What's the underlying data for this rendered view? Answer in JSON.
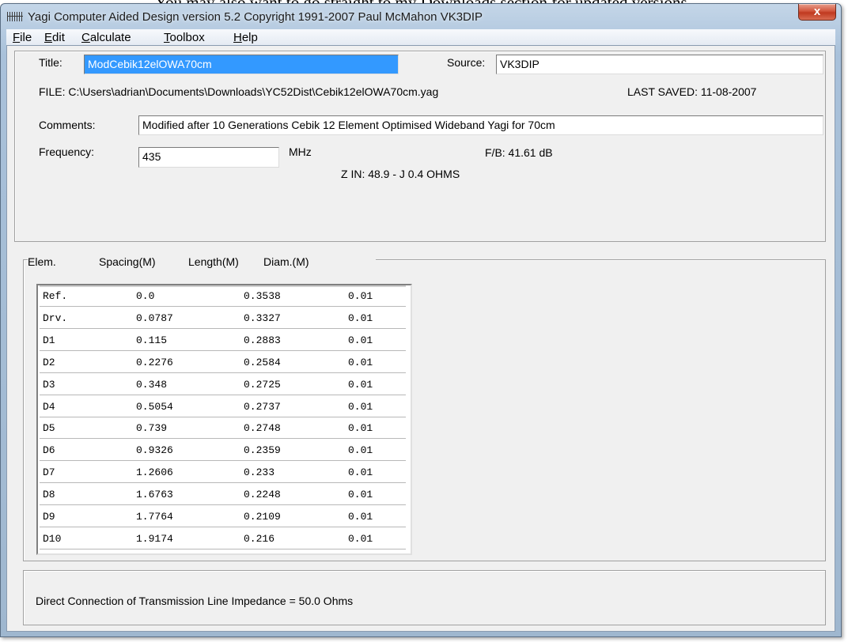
{
  "window": {
    "title": "Yagi Computer Aided Design version 5.2 Copyright 1991-2007 Paul McMahon VK3DIP",
    "close_label": "x",
    "icon": "antenna-grid-icon"
  },
  "background_text": "You may also want to go straight to my Downloads section for updated versions",
  "menu": [
    {
      "label": "File",
      "accel": "F",
      "rest": "ile"
    },
    {
      "label": "Edit",
      "accel": "E",
      "rest": "dit"
    },
    {
      "label": "Calculate",
      "accel": "C",
      "rest": "alculate"
    },
    {
      "label": "Toolbox",
      "accel": "T",
      "rest": "oolbox"
    },
    {
      "label": "Help",
      "accel": "H",
      "rest": "elp"
    }
  ],
  "design": {
    "title_label": "Title:",
    "title_value": "ModCebik12elOWA70cm",
    "source_label": "Source:",
    "source_value": "VK3DIP",
    "file_line": "FILE: C:\\Users\\adrian\\Documents\\Downloads\\YC52Dist\\Cebik12elOWA70cm.yag",
    "last_saved": "LAST SAVED: 11-08-2007",
    "comments_label": "Comments:",
    "comments_value": "Modified after 10 Generations Cebik 12 Element Optimised Wideband Yagi for 70cm",
    "frequency_label": "Frequency:",
    "frequency_value": "435",
    "frequency_unit": "MHz",
    "fb": "F/B: 41.61 dB",
    "zin": "Z IN: 48.9 - J 0.4 OHMS"
  },
  "elements": {
    "headers": [
      "Elem.",
      "Spacing(M)",
      "Length(M)",
      "Diam.(M)"
    ],
    "rows": [
      [
        "Ref.",
        "0.0",
        "0.3538",
        "0.01"
      ],
      [
        "Drv.",
        "0.0787",
        "0.3327",
        "0.01"
      ],
      [
        "D1",
        "0.115",
        "0.2883",
        "0.01"
      ],
      [
        "D2",
        "0.2276",
        "0.2584",
        "0.01"
      ],
      [
        "D3",
        "0.348",
        "0.2725",
        "0.01"
      ],
      [
        "D4",
        "0.5054",
        "0.2737",
        "0.01"
      ],
      [
        "D5",
        "0.739",
        "0.2748",
        "0.01"
      ],
      [
        "D6",
        "0.9326",
        "0.2359",
        "0.01"
      ],
      [
        "D7",
        "1.2606",
        "0.233",
        "0.01"
      ],
      [
        "D8",
        "1.6763",
        "0.2248",
        "0.01"
      ],
      [
        "D9",
        "1.7764",
        "0.2109",
        "0.01"
      ],
      [
        "D10",
        "1.9174",
        "0.216",
        "0.01"
      ]
    ]
  },
  "status": {
    "connection_text": "Direct Connection of Transmission Line Impedance =  50.0 Ohms"
  }
}
